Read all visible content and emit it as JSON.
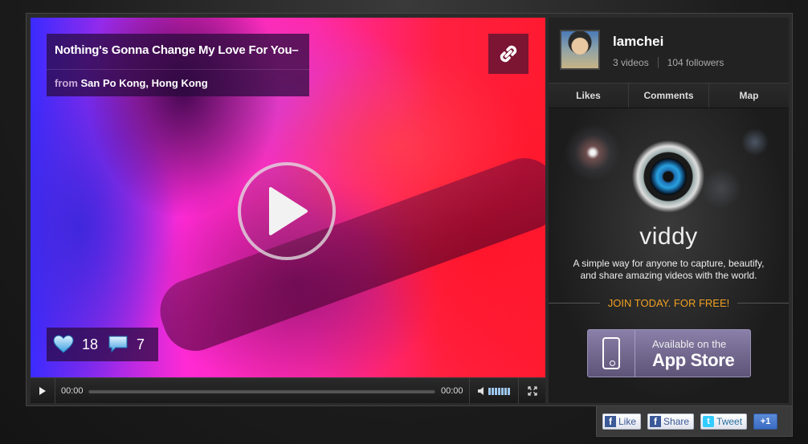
{
  "video": {
    "title": "Nothing's Gonna Change My Love For You–",
    "location_prefix": "from",
    "location": "San Po Kong, Hong Kong",
    "likes": "18",
    "comments": "7",
    "time_current": "00:00",
    "time_total": "00:00"
  },
  "profile": {
    "username": "lamchei",
    "videos": "3 videos",
    "followers": "104 followers"
  },
  "tabs": [
    "Likes",
    "Comments",
    "Map"
  ],
  "promo": {
    "brand": "viddy",
    "tagline": "A simple way for anyone to capture, beautify, and share amazing videos with the world.",
    "join": "JOIN TODAY. FOR FREE!",
    "appstore_small": "Available on the",
    "appstore_big": "App Store"
  },
  "social": {
    "like": "Like",
    "share": "Share",
    "tweet": "Tweet",
    "plusone": "+1"
  },
  "colors": {
    "accent": "#f0a020",
    "facebook": "#3b5998"
  }
}
